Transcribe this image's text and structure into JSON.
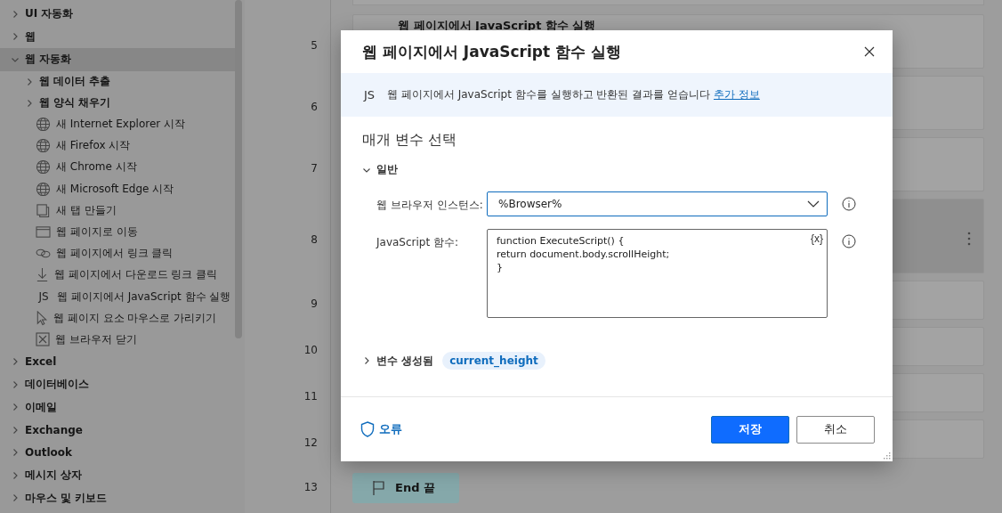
{
  "sidebar": {
    "items": [
      {
        "label": "UI 자동화",
        "kind": "group",
        "expanded": false,
        "selected": false
      },
      {
        "label": "웹",
        "kind": "group",
        "expanded": false,
        "selected": false
      },
      {
        "label": "웹 자동화",
        "kind": "group",
        "expanded": true,
        "selected": true,
        "children": [
          {
            "label": "웹 데이터 추출",
            "kind": "group",
            "expanded": false,
            "selected": false
          },
          {
            "label": "웹 양식 채우기",
            "kind": "group",
            "expanded": false,
            "selected": false
          },
          {
            "label": "새 Internet Explorer 시작",
            "kind": "globe",
            "selected": false
          },
          {
            "label": "새 Firefox 시작",
            "kind": "globe",
            "selected": false
          },
          {
            "label": "새 Chrome 시작",
            "kind": "globe",
            "selected": false
          },
          {
            "label": "새 Microsoft Edge 시작",
            "kind": "globe",
            "selected": false
          },
          {
            "label": "새 탭 만들기",
            "kind": "tab",
            "selected": false
          },
          {
            "label": "웹 페이지로 이동",
            "kind": "window",
            "selected": false
          },
          {
            "label": "웹 페이지에서 링크 클릭",
            "kind": "link",
            "selected": false
          },
          {
            "label": "웹 페이지에서 다운로드 링크 클릭",
            "kind": "download",
            "selected": false
          },
          {
            "label": "웹 페이지에서 JavaScript 함수 실행",
            "kind": "js",
            "icon_text": "JS",
            "selected": false
          },
          {
            "label": "웹 페이지 요소 마우스로 가리키기",
            "kind": "pointer",
            "selected": false
          },
          {
            "label": "웹 브라우저 닫기",
            "kind": "closebox",
            "selected": false
          }
        ]
      },
      {
        "label": "Excel",
        "kind": "group",
        "expanded": false,
        "selected": false
      },
      {
        "label": "데이터베이스",
        "kind": "group",
        "expanded": false,
        "selected": false
      },
      {
        "label": "이메일",
        "kind": "group",
        "expanded": false,
        "selected": false
      },
      {
        "label": "Exchange",
        "kind": "group",
        "expanded": false,
        "selected": false
      },
      {
        "label": "Outlook",
        "kind": "group",
        "expanded": false,
        "selected": false
      },
      {
        "label": "메시지 상자",
        "kind": "group",
        "expanded": false,
        "selected": false
      },
      {
        "label": "마우스 및 키보드",
        "kind": "group",
        "expanded": false,
        "selected": false
      }
    ]
  },
  "flow": {
    "steps": [
      {
        "number": "5",
        "kind": "action",
        "title": "웹 페이지에서 JavaScript 함수 실행",
        "selected": false
      },
      {
        "number": "6",
        "kind": "action",
        "selected": false
      },
      {
        "number": "7",
        "kind": "action",
        "selected": false
      },
      {
        "number": "8",
        "kind": "action",
        "selected": true
      },
      {
        "number": "9",
        "kind": "short",
        "selected": false
      },
      {
        "number": "10",
        "kind": "short",
        "selected": false
      },
      {
        "number": "11",
        "kind": "short",
        "selected": false
      },
      {
        "number": "12",
        "kind": "short",
        "selected": false
      },
      {
        "number": "13",
        "kind": "end",
        "title": "End 끝"
      }
    ]
  },
  "dialog": {
    "title": "웹 페이지에서 JavaScript 함수 실행",
    "info": {
      "icon_text": "JS",
      "text": "웹 페이지에서 JavaScript 함수를 실행하고 반환된 결과를 얻습니다",
      "link": "추가 정보"
    },
    "section_title": "매개 변수 선택",
    "general": {
      "label": "일반",
      "expanded": true
    },
    "fields": [
      {
        "kind": "dropdown",
        "label": "웹 브라우저 인스턴스:",
        "value": "%Browser%",
        "focused": true
      },
      {
        "kind": "code",
        "label": "JavaScript 함수:",
        "value": "function ExecuteScript() {\nreturn document.body.scrollHeight;\n}",
        "variable_button": "{x}",
        "focused": false
      }
    ],
    "variables": {
      "label": "변수 생성됨",
      "expanded": false,
      "chips": [
        "current_height"
      ]
    },
    "error_link": "오류",
    "buttons": [
      {
        "label": "저장",
        "kind": "primary"
      },
      {
        "label": "취소",
        "kind": "secondary"
      }
    ]
  }
}
